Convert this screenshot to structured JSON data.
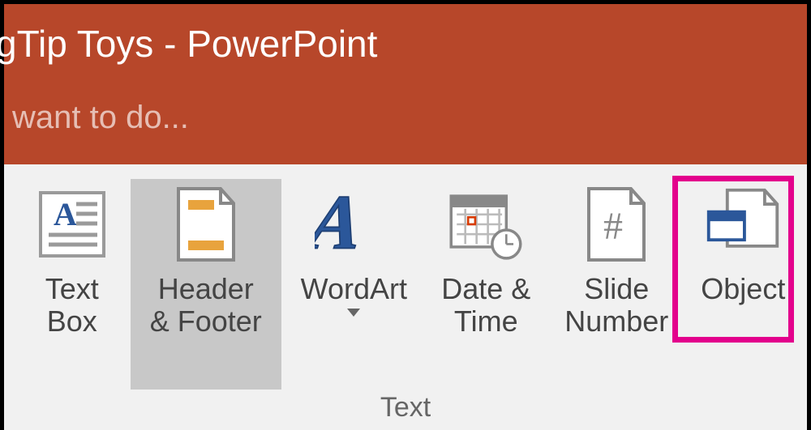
{
  "title": "gTip Toys - PowerPoint",
  "tellme_placeholder": "want to do...",
  "group_label": "Text",
  "buttons": {
    "textbox": {
      "line1": "Text",
      "line2": "Box"
    },
    "header": {
      "line1": "Header",
      "line2": "& Footer"
    },
    "wordart": {
      "line1": "WordArt"
    },
    "datetime": {
      "line1": "Date &",
      "line2": "Time"
    },
    "slidenum": {
      "line1": "Slide",
      "line2": "Number"
    },
    "object": {
      "line1": "Object"
    }
  }
}
